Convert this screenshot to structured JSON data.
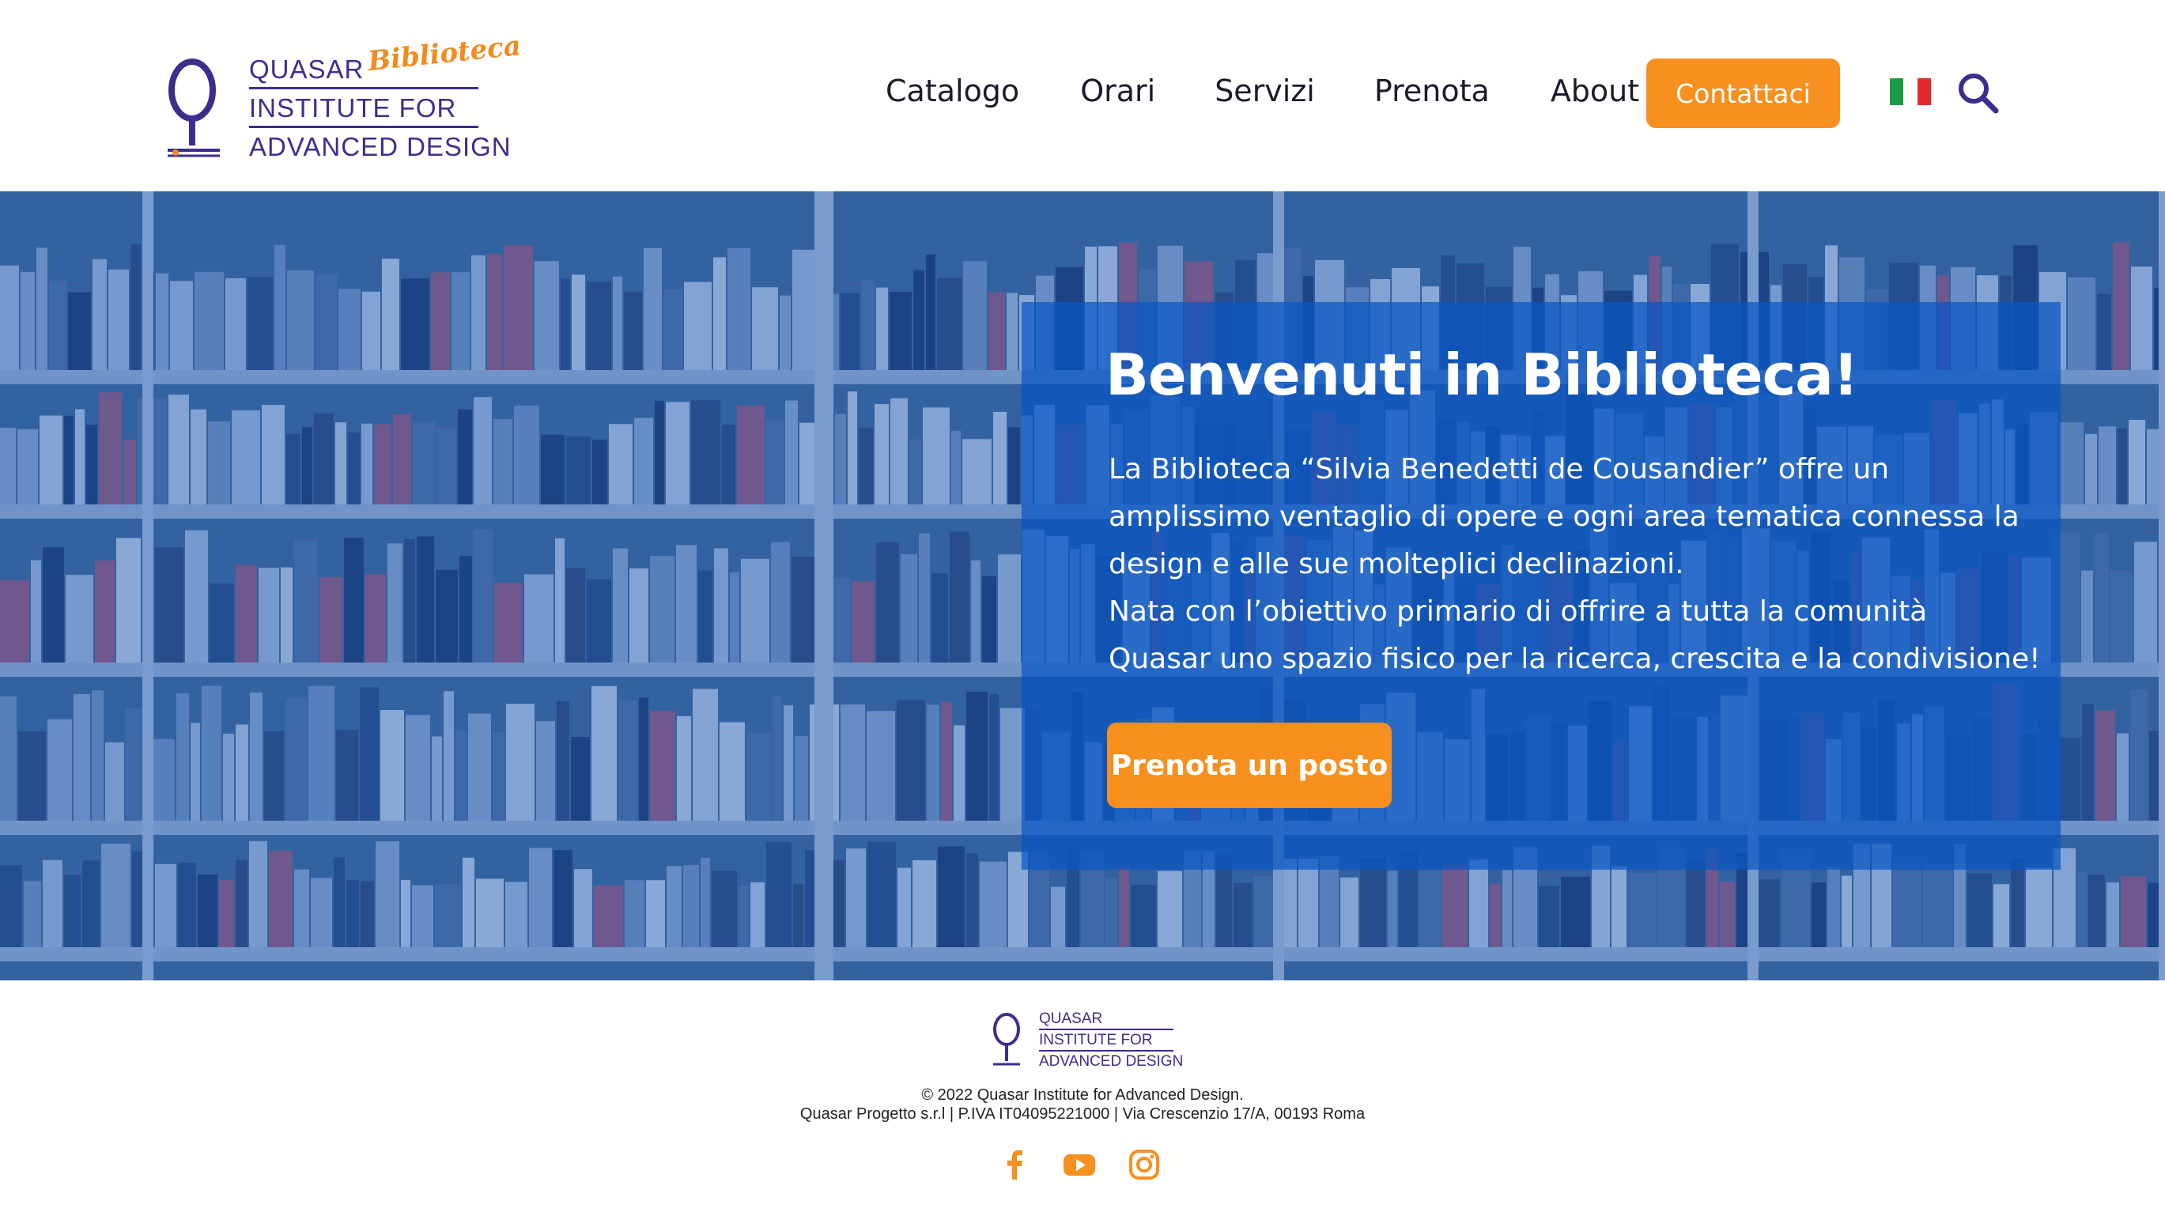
{
  "header": {
    "logo": {
      "line1": "QUASAR",
      "line2": "INSTITUTE FOR",
      "line3": "ADVANCED DESIGN",
      "script": "Biblioteca"
    },
    "nav": [
      {
        "label": "Catalogo"
      },
      {
        "label": "Orari"
      },
      {
        "label": "Servizi"
      },
      {
        "label": "Prenota"
      },
      {
        "label": "About"
      }
    ],
    "contact_label": "Contattaci",
    "language_icon": "italy-flag-icon",
    "search_icon": "search-icon"
  },
  "hero": {
    "title": "Benvenuti in Biblioteca!",
    "lines": [
      "La Biblioteca “Silvia Benedetti de Cousandier” offre un",
      "amplissimo ventaglio di opere e ogni area tematica connessa la",
      "design e alle sue molteplici declinazioni.",
      "Nata con l’obiettivo primario di offrire a tutta la comunità",
      "Quasar uno spazio fisico per la ricerca, crescita e la condivisione!"
    ],
    "cta_label": "Prenota un posto"
  },
  "footer": {
    "logo": {
      "line1": "QUASAR",
      "line2": "INSTITUTE FOR",
      "line3": "ADVANCED DESIGN"
    },
    "copyright": "© 2022 Quasar Institute for Advanced Design.",
    "company": "Quasar Progetto s.r.l | P.IVA IT04095221000 | Via Crescenzio 17/A, 00193 Roma",
    "socials": [
      "facebook-icon",
      "youtube-icon",
      "instagram-icon"
    ]
  },
  "colors": {
    "brand_purple": "#3a2f8f",
    "accent_orange": "#f7901e",
    "hero_blue": "#0856c4"
  }
}
